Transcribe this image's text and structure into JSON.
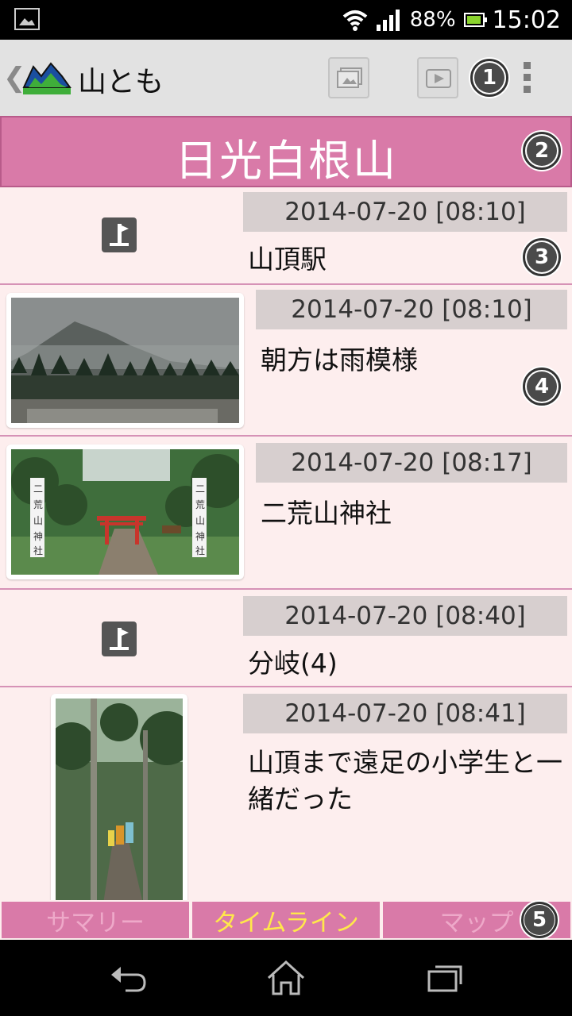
{
  "status_bar": {
    "battery": "88%",
    "time": "15:02"
  },
  "app": {
    "title": "山とも"
  },
  "callouts": [
    "1",
    "2",
    "3",
    "4",
    "5"
  ],
  "mountain": {
    "name": "日光白根山"
  },
  "entries": [
    {
      "type": "waypoint",
      "date": "2014-07-20 [08:10]",
      "text": "山頂駅"
    },
    {
      "type": "photo",
      "date": "2014-07-20 [08:10]",
      "text": "朝方は雨模様"
    },
    {
      "type": "photo",
      "date": "2014-07-20 [08:17]",
      "text": "二荒山神社"
    },
    {
      "type": "waypoint",
      "date": "2014-07-20 [08:40]",
      "text": "分岐(4)"
    },
    {
      "type": "photo",
      "date": "2014-07-20 [08:41]",
      "text": "山頂まで遠足の小学生と一緒だった"
    }
  ],
  "tabs": [
    {
      "label": "サマリー",
      "active": false
    },
    {
      "label": "タイムライン",
      "active": true
    },
    {
      "label": "マップ",
      "active": false
    }
  ],
  "colors": {
    "accent": "#d97aa8",
    "list_bg": "#fdeeee",
    "active_tab_text": "#ffe84a"
  },
  "icons": [
    "gallery-icon",
    "wifi-icon",
    "signal-icon",
    "battery-icon",
    "back-chevron-icon",
    "app-logo-icon",
    "photo-album-icon",
    "play-icon",
    "overflow-menu-icon",
    "waypoint-icon",
    "nav-back-icon",
    "nav-home-icon",
    "nav-recents-icon"
  ]
}
